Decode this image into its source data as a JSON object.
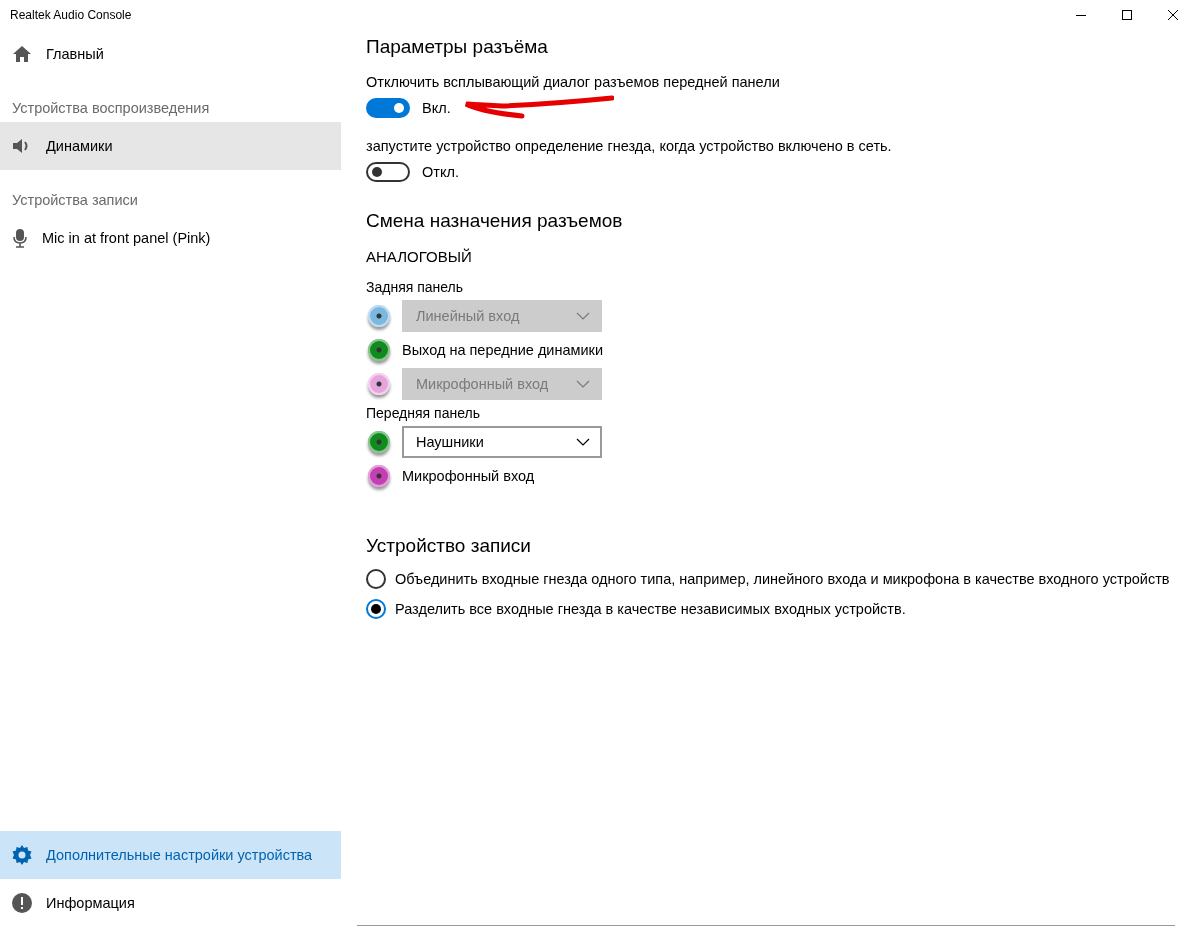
{
  "window": {
    "title": "Realtek Audio Console"
  },
  "sidebar": {
    "items": [
      {
        "kind": "nav",
        "label": "Главный",
        "selected": false
      },
      {
        "kind": "header",
        "label": "Устройства воспроизведения"
      },
      {
        "kind": "nav",
        "label": "Динамики",
        "selected": true
      },
      {
        "kind": "header",
        "label": "Устройства записи"
      },
      {
        "kind": "nav",
        "label": "Mic in at front panel (Pink)",
        "selected": false
      }
    ],
    "bottom_items": [
      {
        "kind": "nav",
        "label": "Дополнительные настройки устройства",
        "selected": true
      },
      {
        "kind": "nav",
        "label": "Информация",
        "selected": false
      }
    ]
  },
  "jack_settings": {
    "title": "Параметры разъёма",
    "toggles": [
      {
        "label": "Отключить всплывающий диалог разъемов передней панели",
        "on": true,
        "state_text": "Вкл."
      },
      {
        "label": "запустите устройство определение гнезда, когда  устройство включено в сеть.",
        "on": false,
        "state_text": "Откл."
      }
    ]
  },
  "jack_reassignment": {
    "title": "Смена назначения разъемов",
    "subtitle": "АНАЛОГОВЫЙ",
    "panels": [
      {
        "title": "Задняя панель",
        "jacks": [
          {
            "color": "#7ab8e0",
            "kind": "dropdown",
            "value": "Линейный вход",
            "disabled": true
          },
          {
            "color": "#118a1e",
            "kind": "label",
            "value": "Выход на передние динамики"
          },
          {
            "color": "#e6a4dc",
            "kind": "dropdown",
            "value": "Микрофонный вход",
            "disabled": true
          }
        ]
      },
      {
        "title": "Передняя панель",
        "jacks": [
          {
            "color": "#118a1e",
            "kind": "dropdown",
            "value": "Наушники",
            "disabled": false
          },
          {
            "color": "#c43fb4",
            "kind": "label",
            "value": "Микрофонный вход"
          }
        ]
      }
    ]
  },
  "recording_device": {
    "title": "Устройство записи",
    "options": [
      {
        "label": "Объединить входные гнезда одного типа, например, линейного входа и микрофона в качестве входного устройств",
        "selected": false
      },
      {
        "label": "Разделить все входные гнезда в качестве независимых входных устройств.",
        "selected": true
      }
    ]
  }
}
